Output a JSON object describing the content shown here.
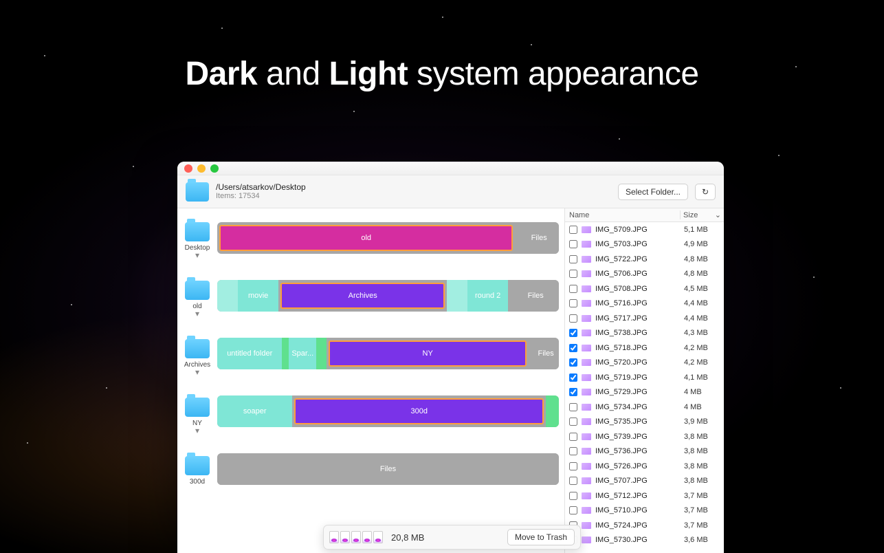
{
  "headline": {
    "w1": "Dark",
    "w2": "and",
    "w3": "Light",
    "w4": "system appearance"
  },
  "toolbar": {
    "path": "/Users/atsarkov/Desktop",
    "items_label": "Items: 17534",
    "select_folder": "Select Folder...",
    "refresh_glyph": "↻"
  },
  "levels": [
    {
      "label": "Desktop"
    },
    {
      "label": "old"
    },
    {
      "label": "Archives"
    },
    {
      "label": "NY"
    },
    {
      "label": "300d"
    }
  ],
  "bars": [
    {
      "segments": [
        {
          "text": "old",
          "cls": "c-magenta outlined",
          "w": 86
        },
        {
          "text": "Files",
          "cls": "c-grey",
          "w": 14
        }
      ]
    },
    {
      "segments": [
        {
          "text": "",
          "cls": "c-ltteal",
          "w": 6
        },
        {
          "text": "movie",
          "cls": "c-teal",
          "w": 12
        },
        {
          "text": "Archives",
          "cls": "c-purple outlined",
          "w": 48
        },
        {
          "text": "",
          "cls": "c-ltteal",
          "w": 6
        },
        {
          "text": "round 2",
          "cls": "c-teal",
          "w": 12
        },
        {
          "text": "Files",
          "cls": "c-grey",
          "w": 16
        }
      ]
    },
    {
      "segments": [
        {
          "text": "untitled folder",
          "cls": "c-teal",
          "w": 19
        },
        {
          "text": "",
          "cls": "c-green",
          "w": 2
        },
        {
          "text": "Spar...",
          "cls": "c-teal",
          "w": 8
        },
        {
          "text": "",
          "cls": "c-green",
          "w": 3
        },
        {
          "text": "NY",
          "cls": "c-purple outlined",
          "w": 58
        },
        {
          "text": "Files",
          "cls": "c-grey",
          "w": 10
        }
      ]
    },
    {
      "segments": [
        {
          "text": "soaper",
          "cls": "c-teal",
          "w": 22
        },
        {
          "text": "300d",
          "cls": "c-purple outlined",
          "w": 73
        },
        {
          "text": "",
          "cls": "c-green",
          "w": 5
        }
      ]
    },
    {
      "segments": [
        {
          "text": "Files",
          "cls": "c-grey",
          "w": 100
        }
      ]
    }
  ],
  "columns": {
    "name": "Name",
    "size": "Size",
    "sort_glyph": "⌄"
  },
  "files": [
    {
      "name": "IMG_5709.JPG",
      "size": "5,1 MB",
      "checked": false
    },
    {
      "name": "IMG_5703.JPG",
      "size": "4,9 MB",
      "checked": false
    },
    {
      "name": "IMG_5722.JPG",
      "size": "4,8 MB",
      "checked": false
    },
    {
      "name": "IMG_5706.JPG",
      "size": "4,8 MB",
      "checked": false
    },
    {
      "name": "IMG_5708.JPG",
      "size": "4,5 MB",
      "checked": false
    },
    {
      "name": "IMG_5716.JPG",
      "size": "4,4 MB",
      "checked": false
    },
    {
      "name": "IMG_5717.JPG",
      "size": "4,4 MB",
      "checked": false
    },
    {
      "name": "IMG_5738.JPG",
      "size": "4,3 MB",
      "checked": true
    },
    {
      "name": "IMG_5718.JPG",
      "size": "4,2 MB",
      "checked": true
    },
    {
      "name": "IMG_5720.JPG",
      "size": "4,2 MB",
      "checked": true
    },
    {
      "name": "IMG_5719.JPG",
      "size": "4,1 MB",
      "checked": true
    },
    {
      "name": "IMG_5729.JPG",
      "size": "4 MB",
      "checked": true
    },
    {
      "name": "IMG_5734.JPG",
      "size": "4 MB",
      "checked": false
    },
    {
      "name": "IMG_5735.JPG",
      "size": "3,9 MB",
      "checked": false
    },
    {
      "name": "IMG_5739.JPG",
      "size": "3,8 MB",
      "checked": false
    },
    {
      "name": "IMG_5736.JPG",
      "size": "3,8 MB",
      "checked": false
    },
    {
      "name": "IMG_5726.JPG",
      "size": "3,8 MB",
      "checked": false
    },
    {
      "name": "IMG_5707.JPG",
      "size": "3,8 MB",
      "checked": false
    },
    {
      "name": "IMG_5712.JPG",
      "size": "3,7 MB",
      "checked": false
    },
    {
      "name": "IMG_5710.JPG",
      "size": "3,7 MB",
      "checked": false
    },
    {
      "name": "IMG_5724.JPG",
      "size": "3,7 MB",
      "checked": false
    },
    {
      "name": "IMG_5730.JPG",
      "size": "3,6 MB",
      "checked": false
    }
  ],
  "selection": {
    "size": "20,8 MB",
    "trash_label": "Move to Trash",
    "thumb_count": 5
  }
}
